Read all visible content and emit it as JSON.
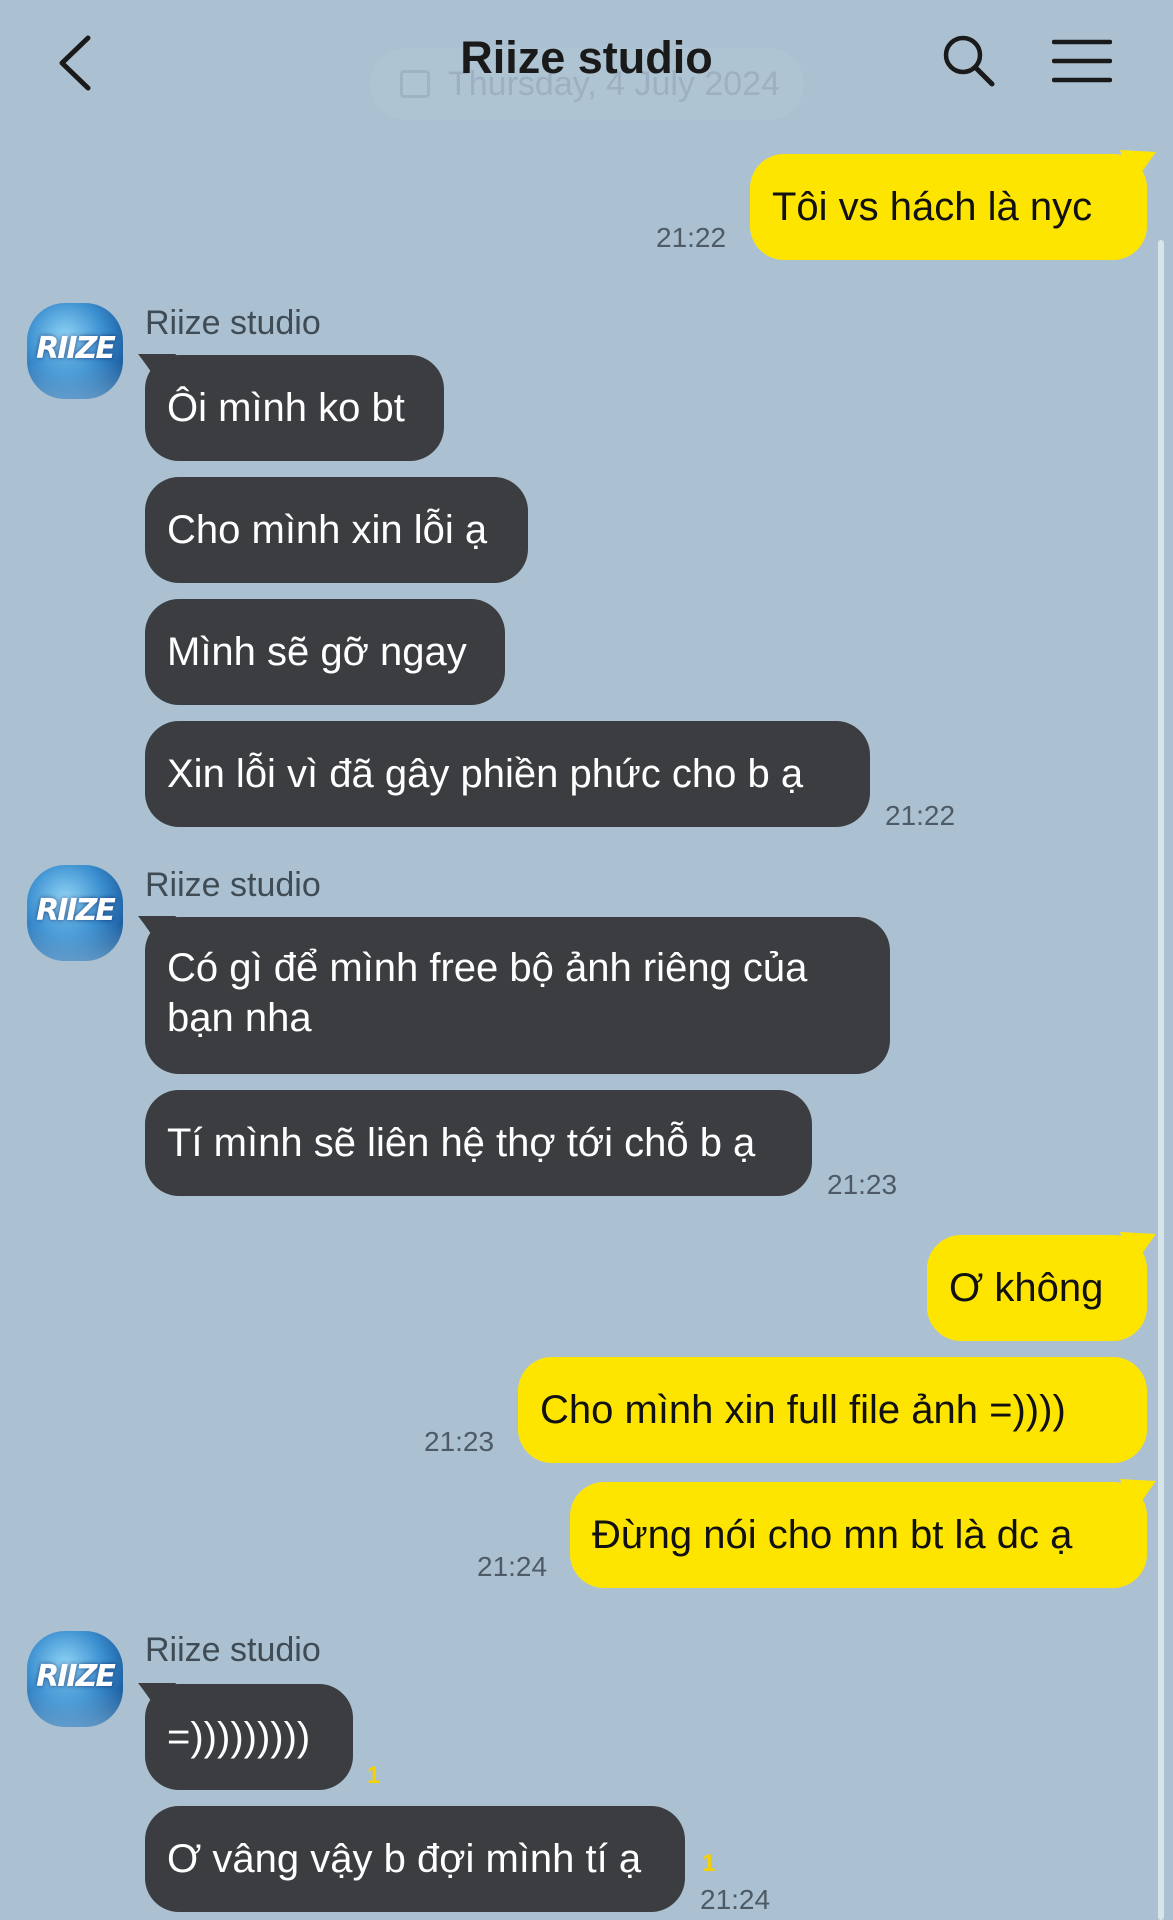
{
  "header": {
    "title": "Riize studio",
    "date_overlay": "Thursday, 4 July 2024"
  },
  "avatar_logo": "RIIZE",
  "messages": {
    "m1": {
      "text": "Tôi vs hách là nyc",
      "time": "21:22"
    },
    "g1": {
      "sender": "Riize studio",
      "b1": "Ôi mình ko bt",
      "b2": "Cho mình xin lỗi ạ",
      "b3": "Mình sẽ gỡ ngay",
      "b4": "Xin lỗi vì đã gây phiền phức cho b ạ",
      "time": "21:22"
    },
    "g2": {
      "sender": "Riize studio",
      "b1": "Có gì để mình free bộ ảnh riêng của bạn nha",
      "b2": "Tí mình sẽ liên hệ thợ tới chỗ b ạ",
      "time": "21:23"
    },
    "m2": {
      "text": "Ơ không"
    },
    "m3": {
      "text": "Cho mình xin full file ảnh =))))",
      "time": "21:23"
    },
    "m4": {
      "text": "Đừng nói cho mn bt là dc ạ",
      "time": "21:24"
    },
    "g3": {
      "sender": "Riize studio",
      "b1": "=)))))))))",
      "b1_unread": "1",
      "b2": "Ơ vâng vậy b đợi mình tí ạ",
      "b2_unread": "1",
      "time": "21:24"
    }
  },
  "colors": {
    "background": "#abc1d1",
    "incoming_bubble": "#3b3d40",
    "outgoing_bubble": "#fee500",
    "unread_count": "#f7d000"
  },
  "icons": {
    "back": "chevron-left-icon",
    "search": "search-icon",
    "menu": "menu-icon"
  }
}
